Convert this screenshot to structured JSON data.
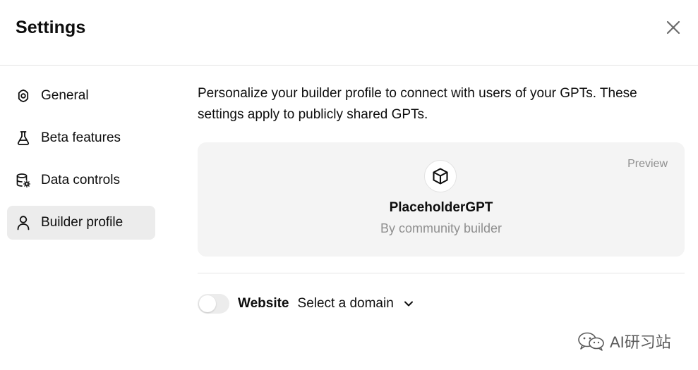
{
  "header": {
    "title": "Settings"
  },
  "sidebar": {
    "items": [
      {
        "label": "General",
        "icon": "gear-icon",
        "active": false
      },
      {
        "label": "Beta features",
        "icon": "flask-icon",
        "active": false
      },
      {
        "label": "Data controls",
        "icon": "database-gear-icon",
        "active": false
      },
      {
        "label": "Builder profile",
        "icon": "user-icon",
        "active": true
      }
    ]
  },
  "builder_profile": {
    "description": "Personalize your builder profile to connect with users of your GPTs. These settings apply to publicly shared GPTs.",
    "preview": {
      "label": "Preview",
      "gpt_icon": "cube-icon",
      "gpt_name": "PlaceholderGPT",
      "author": "By community builder"
    },
    "website": {
      "label": "Website",
      "toggle_on": false,
      "domain_placeholder": "Select a domain"
    }
  },
  "watermark": {
    "text": "AI研习站",
    "icon": "wechat-icon"
  },
  "colors": {
    "active_nav_bg": "#ececec",
    "card_bg": "#f4f4f4",
    "muted_text": "#8f8f8f",
    "divider": "#e5e5e5"
  }
}
